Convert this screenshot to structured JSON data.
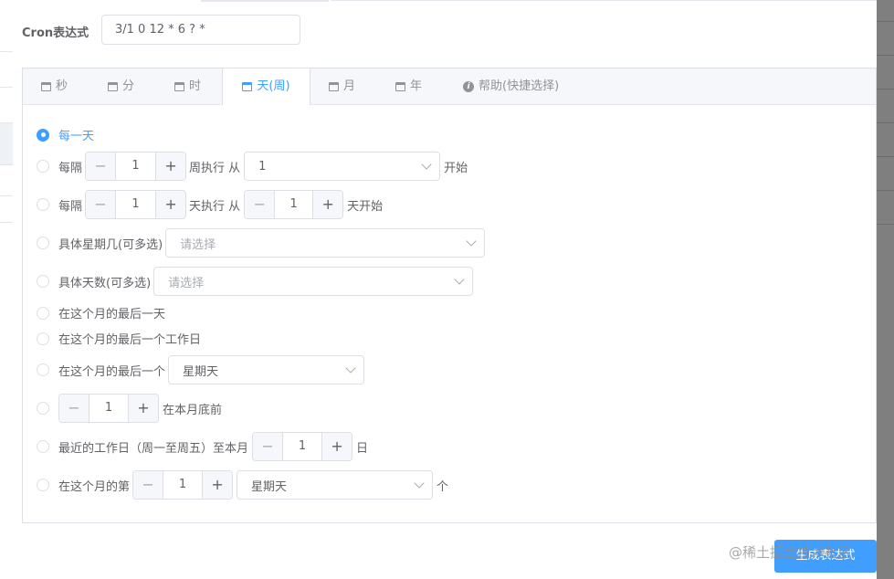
{
  "cron": {
    "label": "Cron表达式",
    "value": "3/1 0 12 * 6 ? *"
  },
  "tabs": [
    {
      "label": "秒",
      "icon": "calendar-icon",
      "active": false
    },
    {
      "label": "分",
      "icon": "calendar-icon",
      "active": false
    },
    {
      "label": "时",
      "icon": "calendar-icon",
      "active": false
    },
    {
      "label": "天(周)",
      "icon": "calendar-icon",
      "active": true
    },
    {
      "label": "月",
      "icon": "calendar-icon",
      "active": false
    },
    {
      "label": "年",
      "icon": "calendar-icon",
      "active": false
    },
    {
      "label": "帮助(快捷选择)",
      "icon": "info-icon",
      "active": false
    }
  ],
  "options": {
    "every_day": {
      "label": "每一天",
      "checked": true
    },
    "every_week": {
      "prefix": "每隔",
      "step_value": "1",
      "mid": "周执行 从",
      "select_value": "1",
      "suffix": "开始",
      "checked": false
    },
    "every_n_days": {
      "prefix": "每隔",
      "step_value": "1",
      "mid": "天执行 从",
      "start_value": "1",
      "suffix": "天开始",
      "checked": false
    },
    "specific_weekdays": {
      "label": "具体星期几(可多选)",
      "placeholder": "请选择",
      "checked": false
    },
    "specific_days": {
      "label": "具体天数(可多选)",
      "placeholder": "请选择",
      "checked": false
    },
    "last_day": {
      "label": "在这个月的最后一天",
      "checked": false
    },
    "last_workday": {
      "label": "在这个月的最后一个工作日",
      "checked": false
    },
    "last_weekday": {
      "label": "在这个月的最后一个",
      "select_value": "星期天",
      "checked": false
    },
    "before_month_end": {
      "step_value": "1",
      "suffix": "在本月底前",
      "checked": false
    },
    "nearest_workday": {
      "label": "最近的工作日（周一至周五）至本月",
      "step_value": "1",
      "suffix": "日",
      "checked": false
    },
    "nth_weekday": {
      "label": "在这个月的第",
      "step_value": "1",
      "select_value": "星期天",
      "suffix": "个",
      "checked": false
    }
  },
  "stepper": {
    "minus": "−",
    "plus": "+"
  },
  "footer": {
    "generate_button": "生成表达式",
    "watermark": "@稀土掘金技术社区"
  },
  "colors": {
    "primary": "#409eff",
    "text": "#606266",
    "border": "#dcdfe6",
    "tab_bg": "#f5f7fa"
  }
}
